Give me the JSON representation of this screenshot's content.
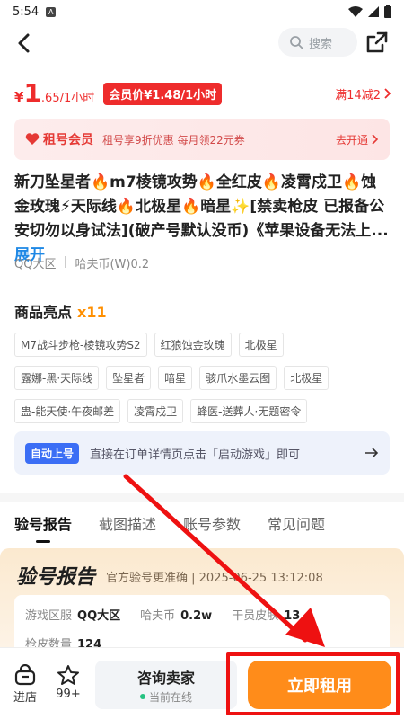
{
  "status_bar": {
    "time": "5:54",
    "badge": "A"
  },
  "nav": {
    "search_placeholder": "搜索"
  },
  "price": {
    "currency": "¥",
    "main": "1",
    "suffix": ".65/1小时",
    "vip_price": "会员价¥1.48/1小时",
    "discount": "满14减2"
  },
  "member_bar": {
    "brand": "租号会员",
    "description": "租号享9折优惠 每月领22元券",
    "action": "去开通"
  },
  "title": {
    "text": "新刀坠星者🔥m7棱镜攻势🔥全红皮🔥凌霄戍卫🔥蚀金玫瑰⚡天际线🔥北极星🔥暗星✨[禁卖枪皮 已报备公安切勿以身试法](破产号默认没币)《苹果设备无法上...",
    "more": "展开"
  },
  "region": {
    "area": "QQ大区",
    "coin": "哈夫币(W)0.2"
  },
  "highlights": {
    "title": "商品亮点",
    "count": "x11",
    "rows": [
      [
        "M7战斗步枪-棱镜攻势S2",
        "红狼蚀金玫瑰",
        "北极星"
      ],
      [
        "露娜-黑·天际线",
        "坠星者",
        "暗星",
        "骇爪水墨云图",
        "北极星"
      ],
      [
        "蛊-能天使·午夜邮差",
        "凌霄戍卫",
        "蜂医-送葬人·无题密令"
      ]
    ]
  },
  "auto_login": {
    "badge": "自动上号",
    "text": "直接在订单详情页点击「启动游戏」即可"
  },
  "tabs": [
    "验号报告",
    "截图描述",
    "账号参数",
    "常见问题"
  ],
  "report": {
    "logo": "验号报告",
    "info": "官方验号更准确 | 2025-06-25 13:12:08",
    "fields": [
      {
        "label": "游戏区服",
        "value": "QQ大区"
      },
      {
        "label": "哈夫币",
        "value": "0.2w"
      },
      {
        "label": "干员皮肤",
        "value": "13"
      }
    ],
    "field2": {
      "label": "枪皮数量",
      "value": "124"
    }
  },
  "bottom": {
    "store": "进店",
    "fav": "99+",
    "consult": "咨询卖家",
    "online": "当前在线",
    "rent": "立即租用"
  },
  "colors": {
    "accent_red": "#ee2c2c",
    "accent_orange": "#ff8c1a",
    "annotation": "#e11111"
  }
}
